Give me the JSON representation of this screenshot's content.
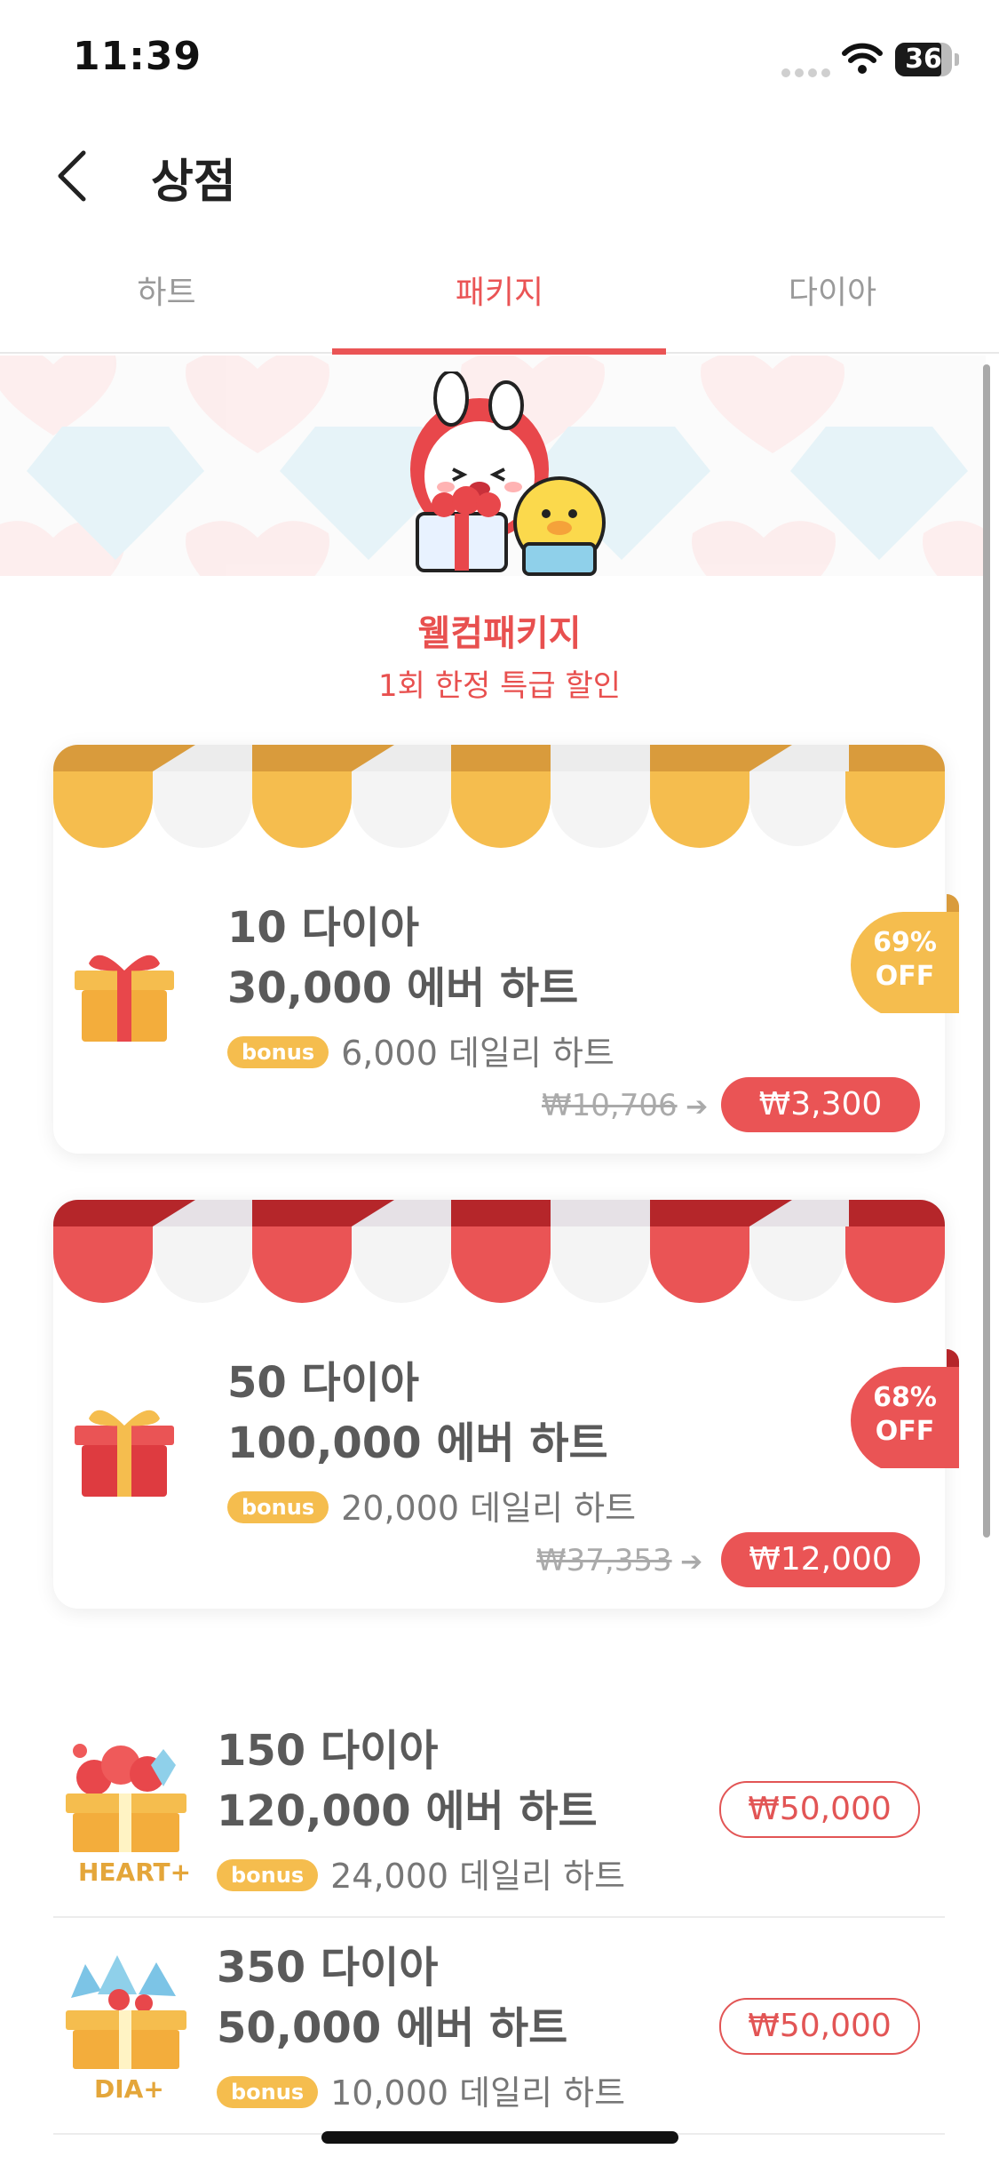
{
  "status_bar": {
    "time": "11:39",
    "battery": "36"
  },
  "header": {
    "title": "상점",
    "back_icon": "chevron-left-icon"
  },
  "tabs": [
    {
      "label": "하트",
      "active": false
    },
    {
      "label": "패키지",
      "active": true
    },
    {
      "label": "다이아",
      "active": false
    }
  ],
  "banner": {
    "title": "웰컴패키지",
    "subtitle": "1회 한정 특급 할인"
  },
  "packages": [
    {
      "line1": "10 다이아",
      "line2": "30,000 에버 하트",
      "bonus_badge": "bonus",
      "bonus_text": "6,000 데일리 하트",
      "original_price": "₩10,706",
      "price": "₩3,300",
      "discount_pct": "69%",
      "discount_label": "OFF",
      "theme": "#f5bd4e"
    },
    {
      "line1": "50 다이아",
      "line2": "100,000 에버 하트",
      "bonus_badge": "bonus",
      "bonus_text": "20,000 데일리 하트",
      "original_price": "₩37,353",
      "price": "₩12,000",
      "discount_pct": "68%",
      "discount_label": "OFF",
      "theme": "#ea5455"
    }
  ],
  "list_items": [
    {
      "line1": "150 다이아",
      "line2": "120,000 에버 하트",
      "bonus_badge": "bonus",
      "bonus_text": "24,000 데일리 하트",
      "price": "₩50,000",
      "icon_label": "HEART+"
    },
    {
      "line1": "350 다이아",
      "line2": "50,000 에버 하트",
      "bonus_badge": "bonus",
      "bonus_text": "10,000 데일리 하트",
      "price": "₩50,000",
      "icon_label": "DIA+"
    }
  ],
  "colors": {
    "accent": "#ea5455",
    "gold": "#f5bd4e",
    "text": "#5a5a5a"
  }
}
